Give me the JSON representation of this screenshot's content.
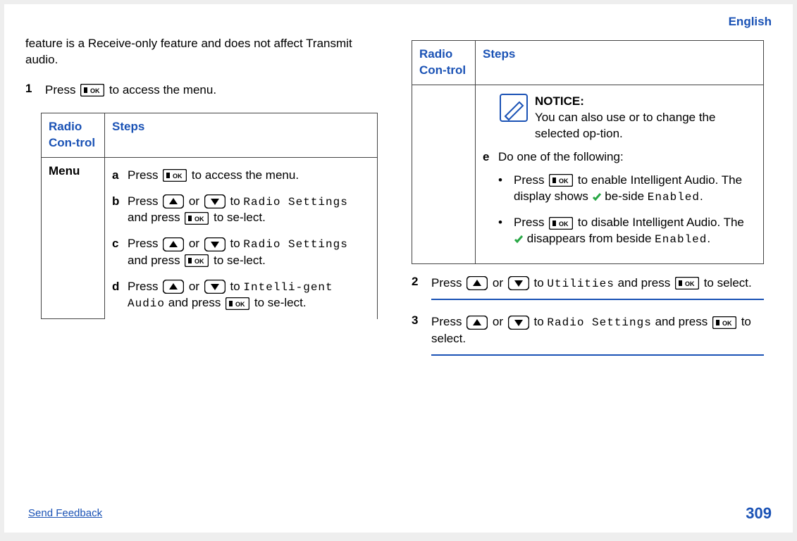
{
  "header": {
    "language": "English"
  },
  "left": {
    "intro": "feature is a Receive-only feature and does not affect Transmit audio.",
    "step1": {
      "num": "1",
      "line_a": "Press ",
      "line_b": " to access the menu."
    },
    "table": {
      "hdr1": "Radio Con-trol",
      "hdr2": "Steps",
      "row_label": "Menu",
      "a": {
        "pre": "Press ",
        "post": " to access the menu."
      },
      "b": {
        "pre": "Press ",
        "mid": " or ",
        "to": " to ",
        "rs": "Radio Settings",
        "and": " and press ",
        "post": " to se-lect."
      },
      "c": {
        "pre": "Press ",
        "mid": " or ",
        "to": " to ",
        "rs": "Radio Settings",
        "and": " and press ",
        "post": " to se-lect."
      },
      "d": {
        "pre": "Press ",
        "mid": " or ",
        "to": " to ",
        "ia": "Intelli-gent Audio",
        "and": " and press ",
        "post": " to se-lect."
      }
    }
  },
  "right": {
    "table": {
      "hdr1": "Radio Con-trol",
      "hdr2": "Steps",
      "notice_title": "NOTICE:",
      "notice_body": "You can also use or to change the selected op-tion.",
      "e_label": "e",
      "e_text": "Do one of the following:",
      "bullet1": {
        "pre": "Press ",
        "mid": " to enable Intelligent Audio. The display shows ",
        "post": " be-side ",
        "en": "Enabled",
        "dot": "."
      },
      "bullet2": {
        "pre": "Press ",
        "mid": " to disable Intelligent Audio. The ",
        "post": " disappears from beside ",
        "en": "Enabled",
        "dot": "."
      }
    },
    "step2": {
      "num": "2",
      "pre": "Press ",
      "mid": " or ",
      "to": " to ",
      "util": "Utilities",
      "and": " and press ",
      "post": " to select."
    },
    "step3": {
      "num": "3",
      "pre": "Press ",
      "mid": " or ",
      "to": " to ",
      "rs": "Radio Settings",
      "and": " and press ",
      "post": " to select."
    }
  },
  "footer": {
    "feedback": "Send Feedback",
    "page": "309"
  }
}
